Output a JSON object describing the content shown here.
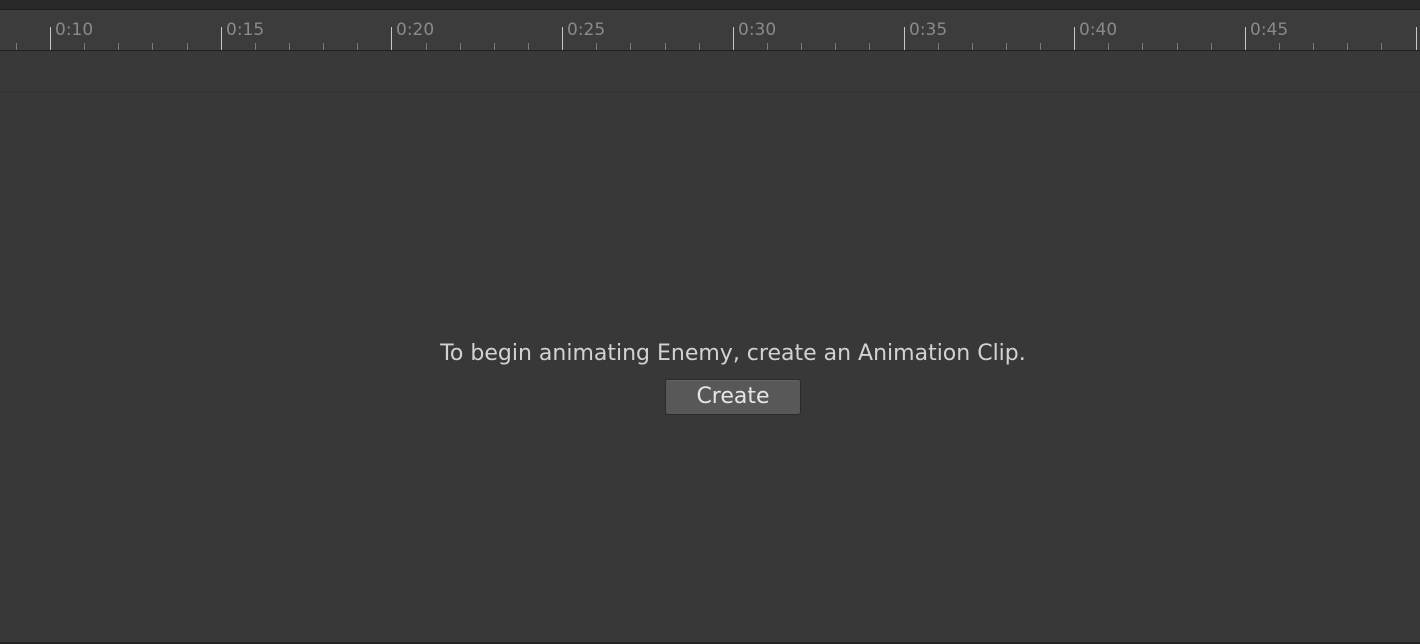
{
  "timeline": {
    "labels": [
      "0:10",
      "0:15",
      "0:20",
      "0:25",
      "0:30",
      "0:35",
      "0:40",
      "0:45"
    ]
  },
  "empty_state": {
    "message": "To begin animating Enemy, create an Animation Clip.",
    "create_label": "Create"
  },
  "colors": {
    "background": "#383838",
    "ruler_background": "#3c3c3c",
    "tick_label": "#8a8a8a",
    "major_tick": "#c8c8c8",
    "minor_tick": "#7a7a7a",
    "message_text": "#d2d2d2",
    "button_background": "#585858"
  }
}
